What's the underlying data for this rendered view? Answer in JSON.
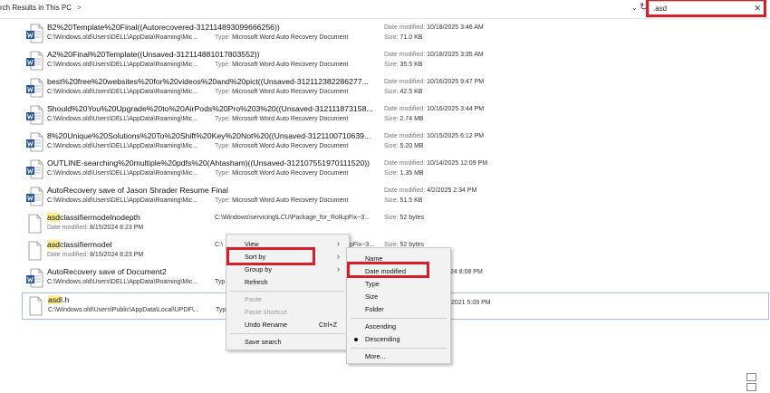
{
  "header": {
    "breadcrumb": "rch Results in This PC",
    "breadcrumb_chevron": ">",
    "dropdown_chevron": "⌄",
    "refresh_icon": "↻",
    "search": {
      "value": ".asd",
      "clear": "✕"
    }
  },
  "labels": {
    "date_modified": "Date modified: ",
    "size": "Size: ",
    "type": "Type: "
  },
  "files": [
    {
      "name": "B2%20Template%20Final((Autorecovered-312114893099666256))",
      "path": "C:\\Windows.old\\Users\\DELL\\AppData\\Roaming\\Mic...",
      "type": "Microsoft Word Auto Recovery Document",
      "date": "10/18/2025 3:46 AM",
      "size": "71.0 KB"
    },
    {
      "name": "A2%20Final%20Template((Unsaved-312114881017803552))",
      "path": "C:\\Windows.old\\Users\\DELL\\AppData\\Roaming\\Mic...",
      "type": "Microsoft Word Auto Recovery Document",
      "date": "10/18/2025 3:35 AM",
      "size": "35.5 KB"
    },
    {
      "name": "best%20free%20websites%20for%20videos%20and%20pict((Unsaved-312112382286277...",
      "path": "C:\\Windows.old\\Users\\DELL\\AppData\\Roaming\\Mic...",
      "type": "Microsoft Word Auto Recovery Document",
      "date": "10/16/2025 9:47 PM",
      "size": "42.5 KB"
    },
    {
      "name": "Should%20You%20Upgrade%20to%20AirPods%20Pro%203%20((Unsaved-312111873158...",
      "path": "C:\\Windows.old\\Users\\DELL\\AppData\\Roaming\\Mic...",
      "type": "Microsoft Word Auto Recovery Document",
      "date": "10/16/2025 3:44 PM",
      "size": "2.74 MB"
    },
    {
      "name": "8%20Unique%20Solutions%20To%20Shift%20Key%20Not%20((Unsaved-3121100710639...",
      "path": "C:\\Windows.old\\Users\\DELL\\AppData\\Roaming\\Mic...",
      "type": "Microsoft Word Auto Recovery Document",
      "date": "10/15/2025 6:12 PM",
      "size": "5.20 MB"
    },
    {
      "name": "OUTLINE-searching%20multiple%20pdfs%20(Ahtasham)((Unsaved-312107551970111520))",
      "path": "C:\\Windows.old\\Users\\DELL\\AppData\\Roaming\\Mic...",
      "type": "Microsoft Word Auto Recovery Document",
      "date": "10/14/2025 12:09 PM",
      "size": "1.35 MB"
    },
    {
      "name": "AutoRecovery save of Jason Shrader Resume Final",
      "path": "C:\\Windows.old\\Users\\DELL\\AppData\\Roaming\\Mic...",
      "type": "Microsoft Word Auto Recovery Document",
      "date": "4/2/2025 2:34 PM",
      "size": "51.5 KB"
    }
  ],
  "plain_files": [
    {
      "hl": "asd",
      "rest": "classifiermodelnodepth",
      "date": "8/15/2024 8:23 PM",
      "path": "C:\\Windows\\servicing\\LCU\\Package_for_RollupFix~3...",
      "size": "52 bytes"
    },
    {
      "hl": "asd",
      "rest": "classifiermodel",
      "date": "8/15/2024 8:23 PM",
      "path": "C:\\",
      "path_tail": "pFix~3...",
      "size": "52 bytes"
    }
  ],
  "file_autorec2": {
    "name": "AutoRecovery save of Document2",
    "path": "C:\\Windows.old\\Users\\DELL\\AppData\\Roaming\\Mic...",
    "type_partial": "Typ",
    "date_partial": "24 8:08 PM"
  },
  "file_asdl": {
    "hl": "asd",
    "rest": "l.h",
    "path": "C:\\Windows.old\\Users\\Public\\AppData\\Local\\UPDF\\...",
    "type_partial": "Typ",
    "date_partial": "2021 5:09 PM"
  },
  "context_menu": {
    "view": "View",
    "sort_by": "Sort by",
    "group_by": "Group by",
    "refresh": "Refresh",
    "paste": "Paste",
    "paste_shortcut": "Paste shortcut",
    "undo_rename": "Undo Rename",
    "undo_shortcut": "Ctrl+Z",
    "save_search": "Save search",
    "arrow": "›"
  },
  "sort_menu": {
    "name": "Name",
    "date_modified": "Date modified",
    "type": "Type",
    "size": "Size",
    "folder": "Folder",
    "ascending": "Ascending",
    "descending": "Descending",
    "more": "More..."
  },
  "colors": {
    "highlight_box": "#d3212b",
    "match_highlight": "#fbef8d",
    "word_blue": "#2b5797"
  }
}
